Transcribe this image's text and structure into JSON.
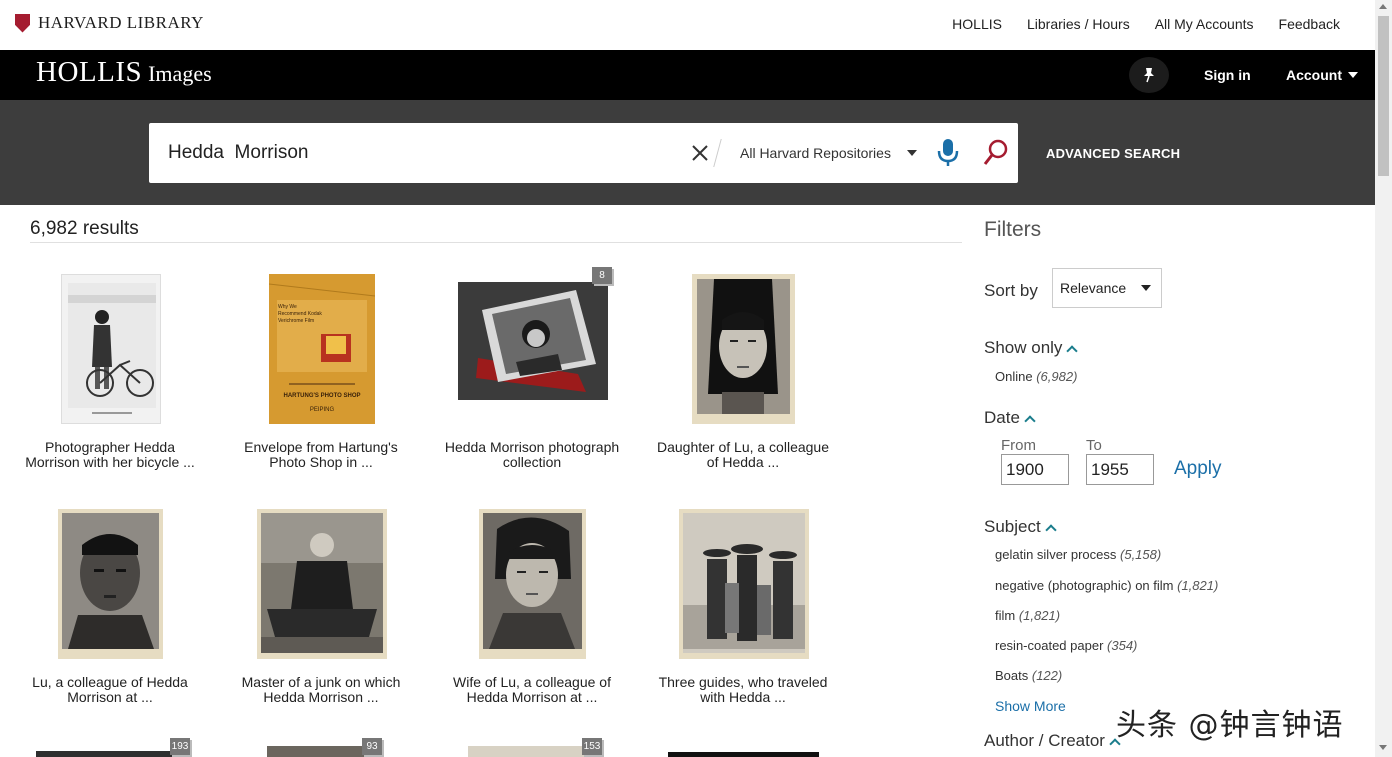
{
  "utility": {
    "logo_text": "HARVARD LIBRARY",
    "nav": [
      "HOLLIS",
      "Libraries / Hours",
      "All My Accounts",
      "Feedback"
    ]
  },
  "header": {
    "logo_main": "HOLLIS",
    "logo_sub": "Images",
    "sign_in": "Sign in",
    "account": "Account"
  },
  "search": {
    "query": "Hedda  Morrison",
    "scope": "All Harvard Repositories",
    "advanced": "ADVANCED SEARCH"
  },
  "results": {
    "count": "6,982 results",
    "row1": [
      {
        "caption_l1": "Photographer Hedda",
        "caption_l2": "Morrison with her bicycle ...",
        "badge": ""
      },
      {
        "caption_l1": "Envelope from Hartung's",
        "caption_l2": "Photo Shop in ...",
        "badge": ""
      },
      {
        "caption_l1": "Hedda Morrison photograph",
        "caption_l2": "collection",
        "badge": "8"
      },
      {
        "caption_l1": "Daughter of Lu, a colleague",
        "caption_l2": "of Hedda ...",
        "badge": ""
      }
    ],
    "row2": [
      {
        "caption_l1": "Lu, a colleague of Hedda",
        "caption_l2": "Morrison at ...",
        "badge": ""
      },
      {
        "caption_l1": "Master of a junk on which",
        "caption_l2": "Hedda Morrison ...",
        "badge": ""
      },
      {
        "caption_l1": "Wife of Lu, a colleague of",
        "caption_l2": "Hedda Morrison at ...",
        "badge": ""
      },
      {
        "caption_l1": "Three guides, who traveled",
        "caption_l2": "with Hedda ...",
        "badge": ""
      }
    ],
    "row3_badges": [
      "193",
      "93",
      "153"
    ],
    "envelope_lines": [
      "Why We",
      "Recommend Kodak",
      "Verichrome Film",
      "HARTUNG'S PHOTO SHOP",
      "PEIPING"
    ]
  },
  "filters": {
    "title": "Filters",
    "sort_label": "Sort by",
    "sort_value": "Relevance",
    "show_only": {
      "heading": "Show only",
      "items": [
        {
          "label": "Online",
          "count": "(6,982)"
        }
      ]
    },
    "date": {
      "heading": "Date",
      "from_label": "From",
      "to_label": "To",
      "from_value": "1900",
      "to_value": "1955",
      "apply": "Apply"
    },
    "subject": {
      "heading": "Subject",
      "items": [
        {
          "label": "gelatin silver process",
          "count": "(5,158)"
        },
        {
          "label": "negative (photographic) on film",
          "count": "(1,821)"
        },
        {
          "label": "film",
          "count": "(1,821)"
        },
        {
          "label": "resin-coated paper",
          "count": "(354)"
        },
        {
          "label": "Boats",
          "count": "(122)"
        }
      ],
      "show_more": "Show More"
    },
    "author": {
      "heading": "Author / Creator"
    }
  },
  "watermark": "头条 @钟言钟语",
  "colors": {
    "accent_teal": "#1b7d8c",
    "link_blue": "#1b6fa8",
    "brand_crimson": "#a51c30"
  }
}
